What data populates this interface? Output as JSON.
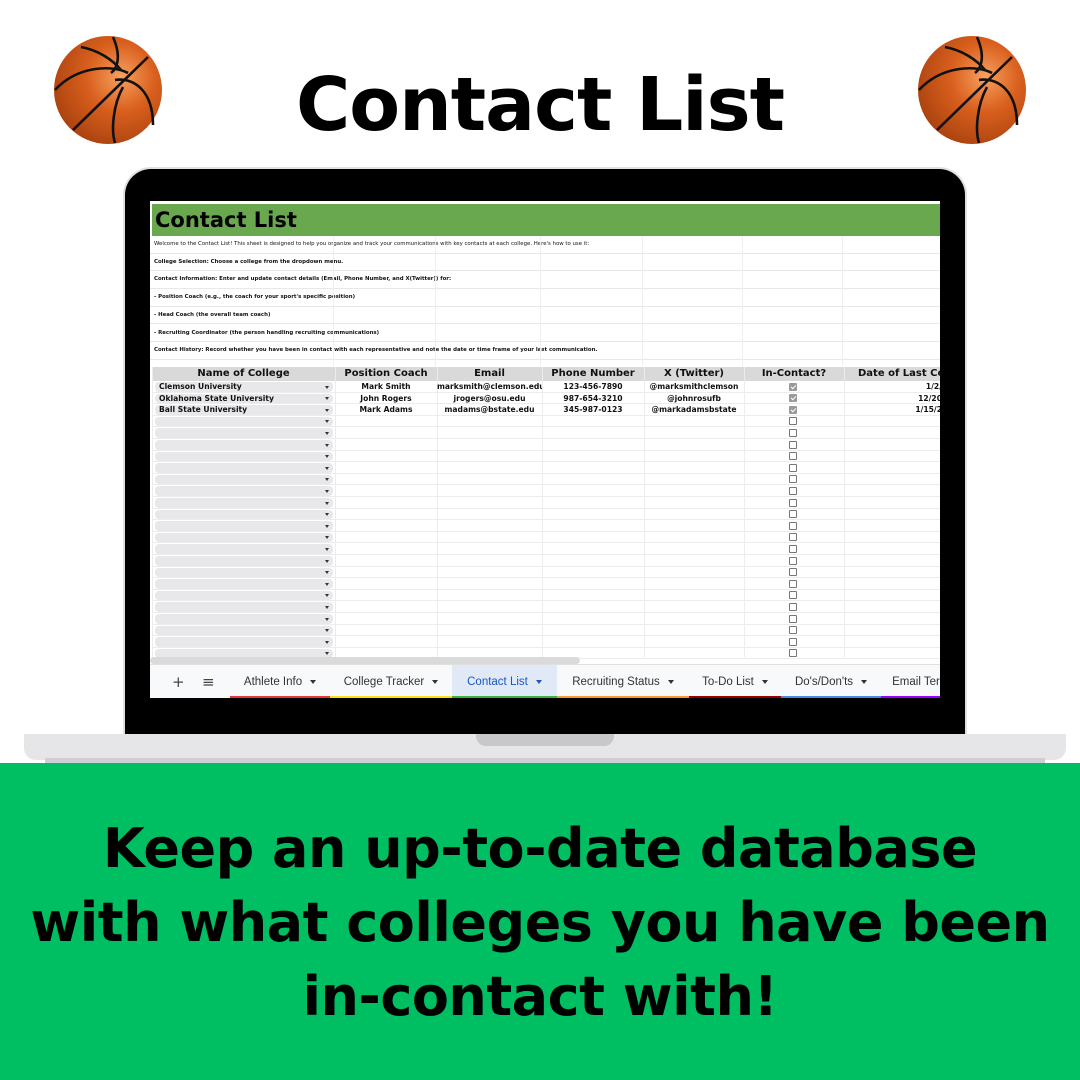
{
  "header": {
    "title": "Contact List"
  },
  "tagline": "Keep an up-to-date database with what colleges you have been in-contact with!",
  "icons": {
    "decoration": "basketball-icon"
  },
  "sheet": {
    "title": "Contact List",
    "intro": [
      {
        "text": "Welcome to the Contact List! This sheet is designed to help you organize and track your communications with key contacts at each college. Here's how to use it:",
        "bold": false
      },
      {
        "text": "College Selection: Choose a college from the dropdown menu.",
        "bold": true
      },
      {
        "text": "Contact Information: Enter and update contact details (Email, Phone Number, and X(Twitter)) for:",
        "bold": true
      },
      {
        "text": "- Position Coach (e.g., the coach for your sport's specific position)",
        "bold": true
      },
      {
        "text": "- Head Coach (the overall team coach)",
        "bold": true
      },
      {
        "text": "- Recruiting Coordinator (the person handling recruiting communications)",
        "bold": true
      },
      {
        "text": "Contact History: Record whether you have been in contact with each representative and note the date or time frame of your last communication.",
        "bold": true
      }
    ],
    "columns": [
      "Name of College",
      "Position Coach",
      "Email",
      "Phone Number",
      "X (Twitter)",
      "In-Contact?",
      "Date of Last Co"
    ],
    "rows": [
      {
        "college": "Clemson University",
        "coach": "Mark Smith",
        "email": "marksmith@clemson.edu",
        "phone": "123-456-7890",
        "twitter": "@marksmithclemson",
        "in_contact": true,
        "date": "1/2/"
      },
      {
        "college": "Oklahoma State University",
        "coach": "John Rogers",
        "email": "jrogers@osu.edu",
        "phone": "987-654-3210",
        "twitter": "@johnrosufb",
        "in_contact": true,
        "date": "12/20"
      },
      {
        "college": "Ball State University",
        "coach": "Mark Adams",
        "email": "madams@bstate.edu",
        "phone": "345-987-0123",
        "twitter": "@markadamsbstate",
        "in_contact": true,
        "date": "1/15/2"
      }
    ],
    "empty_rows": 21
  },
  "tabbar": {
    "add_icon": "+",
    "menu_icon": "≡",
    "tabs": [
      {
        "label": "Athlete Info",
        "color": "#e53935",
        "active": false
      },
      {
        "label": "College Tracker",
        "color": "#f4e01b",
        "active": false
      },
      {
        "label": "Contact List",
        "color": "#3cb044",
        "active": true
      },
      {
        "label": "Recruiting Status",
        "color": "#f39c34",
        "active": false
      },
      {
        "label": "To-Do List",
        "color": "#990000",
        "active": false
      },
      {
        "label": "Do's/Don'ts",
        "color": "#4a86e8",
        "active": false
      },
      {
        "label": "Email Ter",
        "color": "#9900ff",
        "active": false
      }
    ]
  }
}
